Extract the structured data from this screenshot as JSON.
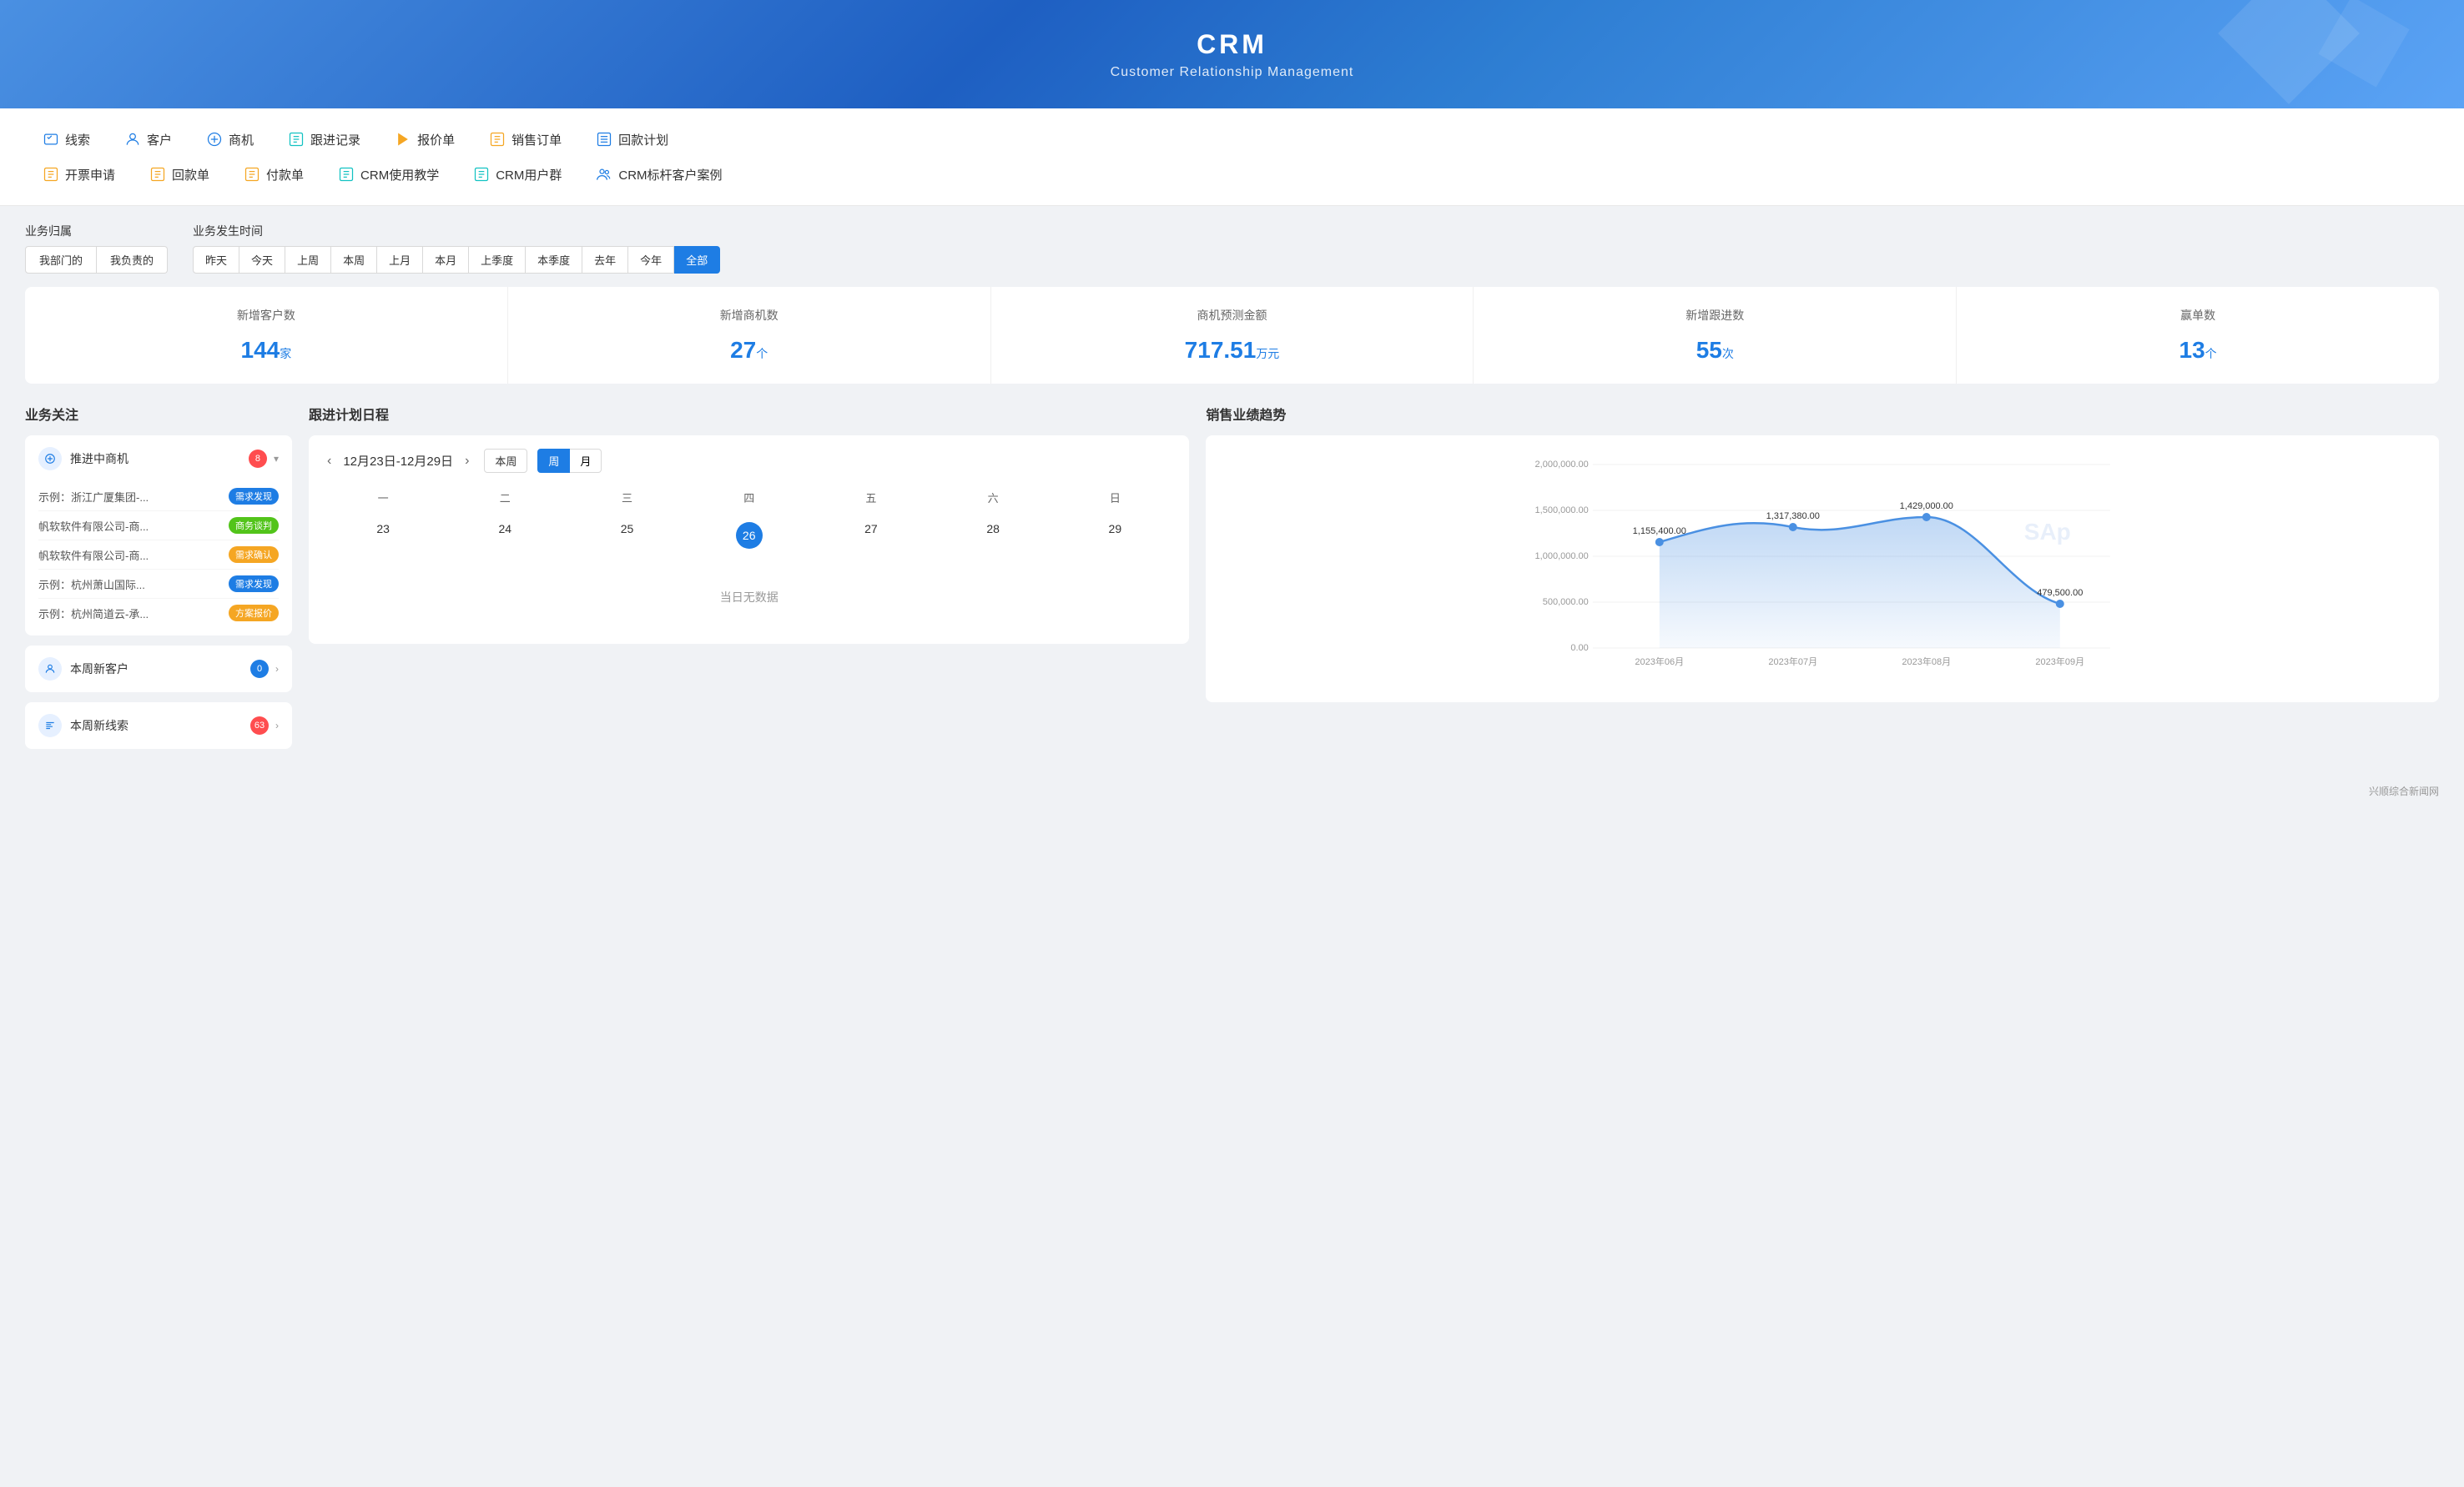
{
  "header": {
    "title": "CRM",
    "subtitle": "Customer Relationship Management"
  },
  "nav": {
    "row1": [
      {
        "id": "leads",
        "icon": "⇌",
        "label": "线索",
        "icon_color": "blue"
      },
      {
        "id": "customers",
        "icon": "👤",
        "label": "客户",
        "icon_color": "blue"
      },
      {
        "id": "opportunities",
        "icon": "⊕",
        "label": "商机",
        "icon_color": "blue"
      },
      {
        "id": "followup",
        "icon": "▦",
        "label": "跟进记录",
        "icon_color": "teal"
      },
      {
        "id": "quotes",
        "icon": "▶",
        "label": "报价单",
        "icon_color": "orange"
      },
      {
        "id": "salesorders",
        "icon": "▨",
        "label": "销售订单",
        "icon_color": "orange"
      },
      {
        "id": "returnplan",
        "icon": "≡",
        "label": "回款计划",
        "icon_color": "blue"
      }
    ],
    "row2": [
      {
        "id": "invoice",
        "icon": "▦",
        "label": "开票申请",
        "icon_color": "orange"
      },
      {
        "id": "refund",
        "icon": "▦",
        "label": "回款单",
        "icon_color": "orange"
      },
      {
        "id": "payment",
        "icon": "▦",
        "label": "付款单",
        "icon_color": "orange"
      },
      {
        "id": "crmtutorial",
        "icon": "≡",
        "label": "CRM使用教学",
        "icon_color": "teal"
      },
      {
        "id": "crmusergroup",
        "icon": "≡",
        "label": "CRM用户群",
        "icon_color": "teal"
      },
      {
        "id": "crmbenchmark",
        "icon": "👥",
        "label": "CRM标杆客户案例",
        "icon_color": "blue"
      }
    ]
  },
  "filters": {
    "ownership_label": "业务归属",
    "ownership_options": [
      {
        "id": "my-dept",
        "label": "我部门的",
        "active": false
      },
      {
        "id": "my-resp",
        "label": "我负责的",
        "active": false
      }
    ],
    "time_label": "业务发生时间",
    "time_options": [
      {
        "id": "yesterday",
        "label": "昨天",
        "active": false
      },
      {
        "id": "today",
        "label": "今天",
        "active": false
      },
      {
        "id": "last-week",
        "label": "上周",
        "active": false
      },
      {
        "id": "this-week",
        "label": "本周",
        "active": false
      },
      {
        "id": "last-month",
        "label": "上月",
        "active": false
      },
      {
        "id": "this-month",
        "label": "本月",
        "active": false
      },
      {
        "id": "last-quarter",
        "label": "上季度",
        "active": false
      },
      {
        "id": "this-quarter",
        "label": "本季度",
        "active": false
      },
      {
        "id": "last-year",
        "label": "去年",
        "active": false
      },
      {
        "id": "this-year",
        "label": "今年",
        "active": false
      },
      {
        "id": "all",
        "label": "全部",
        "active": true
      }
    ]
  },
  "stats": [
    {
      "id": "new-customers",
      "label": "新增客户数",
      "value": "144",
      "unit": "家"
    },
    {
      "id": "new-opportunities",
      "label": "新增商机数",
      "value": "27",
      "unit": "个"
    },
    {
      "id": "opp-forecast",
      "label": "商机预测金额",
      "value": "717.51",
      "unit": "万元"
    },
    {
      "id": "new-followups",
      "label": "新增跟进数",
      "value": "55",
      "unit": "次"
    },
    {
      "id": "wins",
      "label": "赢单数",
      "value": "13",
      "unit": "个"
    }
  ],
  "business_attention": {
    "title": "业务关注",
    "opportunities": {
      "name": "推进中商机",
      "count": 8,
      "items": [
        {
          "name": "示例：浙江广厦集团-...",
          "tag": "需求发现",
          "tag_type": "blue"
        },
        {
          "name": "帆软软件有限公司-商...",
          "tag": "商务谈判",
          "tag_type": "green"
        },
        {
          "name": "帆软软件有限公司-商...",
          "tag": "需求确认",
          "tag_type": "orange"
        },
        {
          "name": "示例：杭州萧山国际...",
          "tag": "需求发现",
          "tag_type": "blue"
        },
        {
          "name": "示例：杭州简道云-承...",
          "tag": "方案报价",
          "tag_type": "orange"
        }
      ]
    },
    "new_customers": {
      "name": "本周新客户",
      "count": 0
    },
    "new_leads": {
      "name": "本周新线索",
      "count": 63
    }
  },
  "calendar": {
    "title": "跟进计划日程",
    "range": "12月23日-12月29日",
    "current_label": "本周",
    "view_week": "周",
    "view_month": "月",
    "day_headers": [
      "一",
      "二",
      "三",
      "四",
      "五",
      "六",
      "日"
    ],
    "days": [
      23,
      24,
      25,
      26,
      27,
      28,
      29
    ],
    "today": 26,
    "no_data": "当日无数据"
  },
  "chart": {
    "title": "销售业绩趋势",
    "y_labels": [
      "2,000,000.00",
      "1,500,000.00",
      "1,000,000.00",
      "500,000.00",
      "0.00"
    ],
    "x_labels": [
      "2023年06月",
      "2023年07月",
      "2023年08月",
      "2023年09月"
    ],
    "data_points": [
      {
        "month": "2023年06月",
        "value": 1155400,
        "label": "1,155,400.00"
      },
      {
        "month": "2023年07月",
        "value": 1317380,
        "label": "1,317,380.00"
      },
      {
        "month": "2023年08月",
        "value": 1429000,
        "label": "1,429,000.00"
      },
      {
        "month": "2023年09月",
        "value": 479500,
        "label": "479,500.00"
      }
    ],
    "y_max": 2000000,
    "sap_label": "SAp"
  },
  "footer": {
    "text": "兴顺综合新闻网"
  }
}
